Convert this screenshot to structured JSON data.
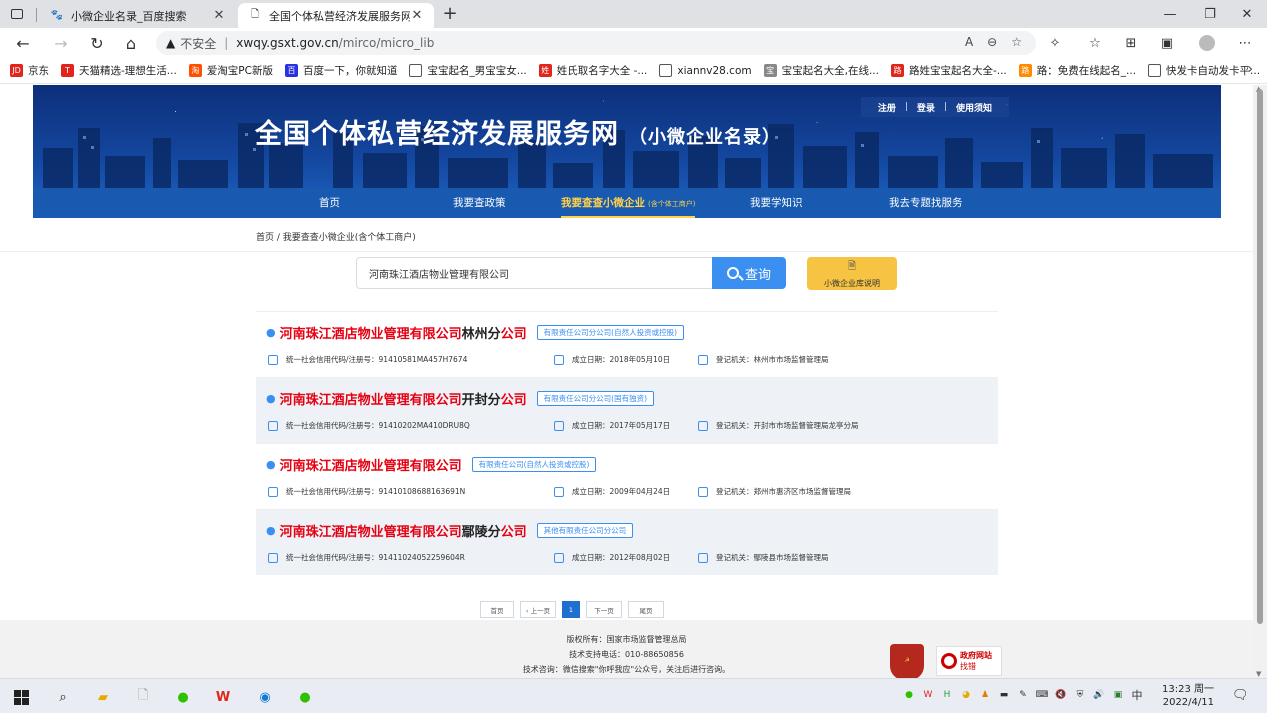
{
  "browser": {
    "tabs": [
      {
        "title": "小微企业名录_百度搜索",
        "favicon": "baidu-paw-icon",
        "active": false
      },
      {
        "title": "全国个体私营经济发展服务网",
        "favicon": "page-icon",
        "active": true
      }
    ],
    "address": {
      "security_label": "不安全",
      "host": "xwqy.gsxt.gov.cn",
      "path": "/mirco/micro_lib"
    },
    "bookmarks": [
      {
        "label": "京东",
        "icon_color": "#e1251b",
        "icon_text": "JD"
      },
      {
        "label": "天猫精选-理想生活...",
        "icon_color": "#e1251b",
        "icon_text": "T"
      },
      {
        "label": "爱淘宝PC新版",
        "icon_color": "#ff5000",
        "icon_text": "淘"
      },
      {
        "label": "百度一下，你就知道",
        "icon_color": "#2932e1",
        "icon_text": "百"
      },
      {
        "label": "宝宝起名_男宝宝女...",
        "icon_color": "#ffffff",
        "icon_text": ""
      },
      {
        "label": "姓氏取名字大全 -...",
        "icon_color": "#e1251b",
        "icon_text": "姓"
      },
      {
        "label": "xiannv28.com",
        "icon_color": "#ffffff",
        "icon_text": ""
      },
      {
        "label": "宝宝起名大全,在线...",
        "icon_color": "#888888",
        "icon_text": "宝"
      },
      {
        "label": "路姓宝宝起名大全-...",
        "icon_color": "#e1251b",
        "icon_text": "路"
      },
      {
        "label": "路：免费在线起名_...",
        "icon_color": "#ff8a00",
        "icon_text": "路"
      },
      {
        "label": "快发卡自动发卡平...",
        "icon_color": "#ffffff",
        "icon_text": ""
      }
    ]
  },
  "site": {
    "title": "全国个体私营经济发展服务网",
    "subtitle": "（小微企业名录）",
    "toplinks": [
      "注册",
      "登录",
      "使用须知"
    ],
    "nav": [
      {
        "label": "首页",
        "active": false
      },
      {
        "label": "我要查政策",
        "active": false
      },
      {
        "label": "我要查查小微企业",
        "note": "(含个体工商户)",
        "active": true
      },
      {
        "label": "我要学知识",
        "active": false
      },
      {
        "label": "我去专题找服务",
        "active": false
      }
    ],
    "breadcrumb": "首页 / 我要查查小微企业(含个体工商户)",
    "search": {
      "value": "河南珠江酒店物业管理有限公司",
      "button": "查询",
      "lib_button": "小微企业库说明"
    },
    "results": [
      {
        "name_hl": "河南珠江酒店物业管理有限公司",
        "name_mid": "林州分",
        "name_hl2": "公司",
        "type": "有限责任公司分公司(自然人投资或控股)",
        "code": "统一社会信用代码/注册号：91410581MA457H7674",
        "date": "成立日期：2018年05月10日",
        "authority": "登记机关：林州市市场监督管理局"
      },
      {
        "name_hl": "河南珠江酒店物业管理有限公司",
        "name_mid": "开封分",
        "name_hl2": "公司",
        "type": "有限责任公司分公司(国有独资)",
        "code": "统一社会信用代码/注册号：91410202MA410DRU8Q",
        "date": "成立日期：2017年05月17日",
        "authority": "登记机关：开封市市场监督管理局龙亭分局"
      },
      {
        "name_hl": "河南珠江酒店物业管理有限公司",
        "name_mid": "",
        "name_hl2": "",
        "type": "有限责任公司(自然人投资或控股)",
        "code": "统一社会信用代码/注册号：91410108688163691N",
        "date": "成立日期：2009年04月24日",
        "authority": "登记机关：郑州市惠济区市场监督管理局"
      },
      {
        "name_hl": "河南珠江酒店物业管理有限公司",
        "name_mid": "鄢陵分",
        "name_hl2": "公司",
        "type": "其他有限责任公司分公司",
        "code": "统一社会信用代码/注册号：91411024052259604R",
        "date": "成立日期：2012年08月02日",
        "authority": "登记机关：鄢陵县市场监督管理局"
      }
    ],
    "pager": {
      "first": "首页",
      "prev": "‹ 上一页",
      "current": "1",
      "next": "下一页",
      "last": "尾页"
    },
    "footer": {
      "copyright": "版权所有：国家市场监督管理总局",
      "support": "技术支持电话：010-88650856",
      "consult": "技术咨询：微信搜索\"你呼我应\"公众号，关注后进行咨询。",
      "badge_gov_line1": "政府网站",
      "badge_gov_line2": "找错"
    }
  },
  "taskbar": {
    "time": "13:23 周一",
    "date": "2022/4/11",
    "ime": "中"
  }
}
